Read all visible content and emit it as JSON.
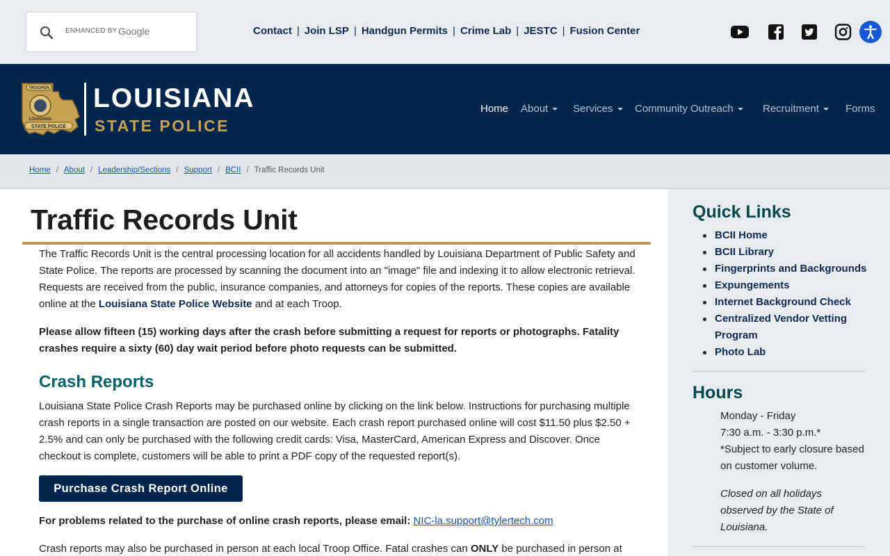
{
  "search": {
    "enhanced_by": "ENHANCED BY",
    "brand": "Google"
  },
  "util_links": [
    "Contact",
    "Join LSP",
    "Handgun Permits",
    "Crime Lab",
    "JESTC",
    "Fusion Center"
  ],
  "social": [
    "youtube-icon",
    "facebook-icon",
    "twitter-icon",
    "instagram-icon",
    "accessibility-icon"
  ],
  "header": {
    "logo_line1": "LOUISIANA",
    "logo_line2": "STATE POLICE",
    "badge_top": "TROOPER",
    "badge_mid": "LOUISIANA",
    "badge_bottom": "STATE POLICE"
  },
  "nav": {
    "home": "Home",
    "about": "About",
    "services": "Services",
    "community": "Community Outreach",
    "recruitment": "Recruitment",
    "forms": "Forms"
  },
  "breadcrumb": {
    "home": "Home",
    "about": "About",
    "leadership": "Leadership/Sections",
    "support": "Support",
    "bcii": "BCII",
    "current": "Traffic Records Unit"
  },
  "main": {
    "title": "Traffic Records Unit",
    "p1_a": "The Traffic Records Unit is the central processing location for all accidents handled by Louisiana Department of Public Safety and State Police. The reports are processed by scanning the document into an \"image\" file and indexing it to allow electronic retrieval. Requests are received from the public, insurance companies, and attorneys for copies of the reports. These copies are available online at the ",
    "p1_link": "Louisiana State Police Website",
    "p1_b": " and at each Troop.",
    "p2": "Please allow fifteen (15) working days after the crash before submitting a request for reports or photographs. Fatality crashes require a sixty (60) day wait period before photo requests can be submitted.",
    "crash_heading": "Crash Reports",
    "p3": "Louisiana State Police Crash Reports may be purchased online by clicking on the link below. Instructions for purchasing multiple crash reports in a single transaction are posted on our website. Each crash report purchased online will cost $11.50 plus $2.50 + 2.5% and can only be purchased with the following credit cards: Visa, MasterCard, American Express and Discover. Once checkout is complete, customers will be able to print a PDF copy of the requested report(s).",
    "buy_button": "Purchase Crash Report Online",
    "email_label": "For problems related to the purchase of online crash reports, please email: ",
    "email": "NIC-la.support@tylertech.com",
    "p4_a": "Crash reports may also be purchased in person at each local Troop Office. Fatal crashes can ",
    "p4_only": "ONLY",
    "p4_b": " be purchased in person at"
  },
  "sidebar": {
    "quick_links_title": "Quick Links",
    "links": [
      "BCII Home",
      "BCII Library",
      "Fingerprints and Backgrounds",
      "Expungements",
      "Internet Background Check",
      "Centralized Vendor Vetting Program",
      "Photo Lab"
    ],
    "hours_title": "Hours",
    "hours_line1": "Monday - Friday",
    "hours_line2": "7:30 a.m. - 3:30 p.m.*",
    "hours_line3": "*Subject to early closure based on customer volume.",
    "closed_note": "Closed on all holidays observed by the State of Louisiana."
  },
  "colors": {
    "navy": "#00264d",
    "gold": "#b8954a",
    "teal_heading": "#006064",
    "link_blue": "#1a56b0"
  }
}
